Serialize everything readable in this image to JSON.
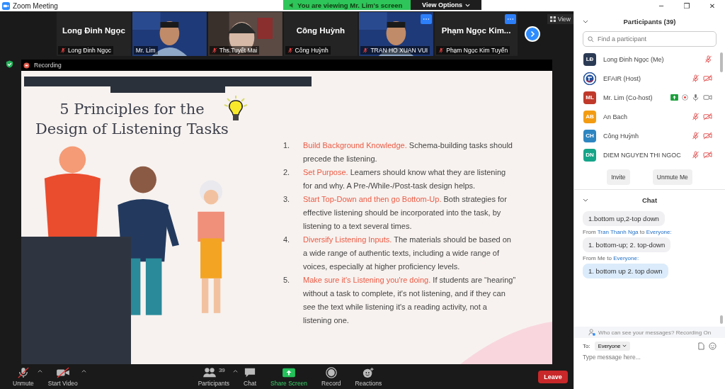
{
  "window": {
    "title": "Zoom Meeting",
    "controls": [
      "─",
      "❐",
      "✕"
    ]
  },
  "share_banner": {
    "text": "You are viewing Mr. Lim's screen",
    "options": "View Options"
  },
  "video_tiles": [
    {
      "kind": "name",
      "display": "Long Đinh Ngọc",
      "caption": "Long Đinh Ngọc",
      "muted": true,
      "more": false
    },
    {
      "kind": "video",
      "caption": "Mr. Lim",
      "muted": false,
      "more": false
    },
    {
      "kind": "video",
      "caption": "Ths.Tuyết Mai",
      "muted": true,
      "more": false
    },
    {
      "kind": "name",
      "display": "Công Huỳnh",
      "caption": "Công Huỳnh",
      "muted": true,
      "more": false
    },
    {
      "kind": "video",
      "caption": "TRAN HO XUAN VUI",
      "muted": true,
      "more": true
    },
    {
      "kind": "name",
      "display": "Phạm Ngọc Kim...",
      "caption": "Phạm Ngọc Kim Tuyến",
      "muted": true,
      "more": true
    }
  ],
  "view_button": "View",
  "recording": "Recording",
  "slide": {
    "title": [
      "5 Principles for the",
      "Design of Listening Tasks"
    ],
    "items": [
      {
        "number": "1.",
        "lead": "Build Background Knowledge.",
        "text": "Schema-building tasks should precede the listening."
      },
      {
        "number": "2.",
        "lead": "Set Purpose.",
        "text": "Leamers should know what they are listening for and why. A Pre-/While-/Post-task design helps."
      },
      {
        "number": "3.",
        "lead": "Start Top-Down and then go Bottom-Up.",
        "text": "Both strategies for effective listening should be incorporated into the task, by listening to a text several times."
      },
      {
        "number": "4.",
        "lead": "Diversify Listening Inputs.",
        "text": "The materials should be based on a wide range of authentic texts, including a wide range of voices, especially at higher proficiency levels."
      },
      {
        "number": "5.",
        "lead": "Make sure it's Listening you're doing.",
        "text": "If students are “hearing” without a task to complete, it's not listening, and if they can see the text while listening it's a reading activity, not a listening one."
      }
    ]
  },
  "toolbar": [
    {
      "kind": "unmute",
      "label": "Unmute",
      "caret": true
    },
    {
      "kind": "video",
      "label": "Start Video",
      "caret": true
    },
    {
      "kind": "participants",
      "label": "Participants",
      "count": "39",
      "caret": true
    },
    {
      "kind": "chat",
      "label": "Chat",
      "caret": false
    },
    {
      "kind": "share",
      "label": "Share Screen",
      "caret": false
    },
    {
      "kind": "record",
      "label": "Record",
      "caret": false
    },
    {
      "kind": "reactions",
      "label": "Reactions",
      "caret": false
    }
  ],
  "leave_button": "Leave",
  "participants": {
    "title": "Participants (39)",
    "search_placeholder": "Find a participant",
    "people": [
      {
        "kind": "initials",
        "initials": "LĐ",
        "color": "#2b3a55",
        "name": "Long Đinh Ngọc (Me)",
        "muted": true,
        "video_shown": false,
        "sharing": false,
        "recording": false
      },
      {
        "kind": "logo",
        "name": "EFAIR (Host)",
        "muted": true,
        "video_shown": true,
        "video_on": false,
        "sharing": false,
        "recording": false
      },
      {
        "kind": "initials",
        "initials": "ML",
        "color": "#c0392b",
        "name": "Mr. Lim (Co-host)",
        "muted": false,
        "video_shown": true,
        "video_on": true,
        "sharing": true,
        "recording": true
      },
      {
        "kind": "initials",
        "initials": "AB",
        "color": "#f39c12",
        "name": "An Bach",
        "muted": true,
        "video_shown": true,
        "video_on": false,
        "sharing": false,
        "recording": false
      },
      {
        "kind": "initials",
        "initials": "CH",
        "color": "#2e86c1",
        "name": "Công Huỳnh",
        "muted": true,
        "video_shown": true,
        "video_on": false,
        "sharing": false,
        "recording": false
      },
      {
        "kind": "initials",
        "initials": "DN",
        "color": "#17a589",
        "name": "DIEM NGUYEN THI NGOC",
        "muted": true,
        "video_shown": true,
        "video_on": false,
        "sharing": false,
        "recording": false
      }
    ],
    "buttons": [
      "Invite",
      "Unmute Me"
    ]
  },
  "chat": {
    "title": "Chat",
    "messages": [
      {
        "text": "1.bottom up,2-top  down",
        "mine": false
      },
      {
        "from": {
          "prefix": "From",
          "sender": "Tran Thanh Nga",
          "sender_link": true,
          "to_word": "to",
          "to": "Everyone:"
        },
        "text": "1. bottom-up; 2. top-down",
        "mine": false
      },
      {
        "from": {
          "prefix": "From",
          "sender": "Me",
          "sender_link": false,
          "to_word": "to",
          "to": "Everyone:"
        },
        "text": "1. bottom up 2. top down",
        "mine": true
      }
    ],
    "privacy": "Who can see your messages? Recording On",
    "to_label": "To:",
    "to_value": "Everyone",
    "input_placeholder": "Type message here..."
  }
}
